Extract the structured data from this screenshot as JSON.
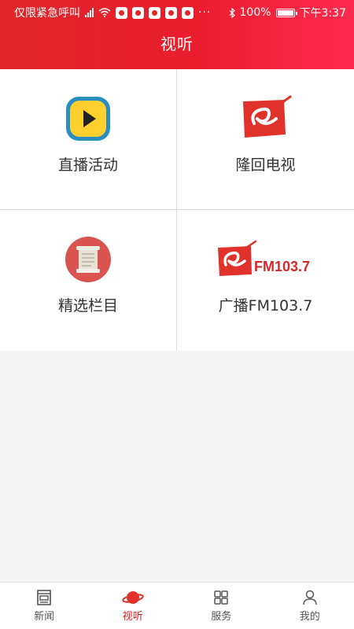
{
  "status_bar": {
    "carrier": "仅限紧急呼叫",
    "battery": "100%",
    "battery_level": 1.0,
    "time": "下午3:37",
    "more": "···"
  },
  "header": {
    "title": "视听"
  },
  "grid": {
    "items": [
      {
        "label": "直播活动",
        "icon": "play-icon"
      },
      {
        "label": "隆回电视",
        "icon": "longhui-tv-logo-icon"
      },
      {
        "label": "精选栏目",
        "icon": "scroll-icon"
      },
      {
        "label": "广播FM103.7",
        "icon": "fm-logo-icon",
        "logo_text": "FM103.7"
      }
    ]
  },
  "tabbar": {
    "tabs": [
      {
        "label": "新闻",
        "icon": "newspaper-icon",
        "active": false
      },
      {
        "label": "视听",
        "icon": "planet-icon",
        "active": true
      },
      {
        "label": "服务",
        "icon": "grid-icon",
        "active": false
      },
      {
        "label": "我的",
        "icon": "person-icon",
        "active": false
      }
    ]
  },
  "colors": {
    "brand": "#e1262a",
    "accent_end": "#ff2b4f",
    "active_tab": "#dd2222"
  }
}
